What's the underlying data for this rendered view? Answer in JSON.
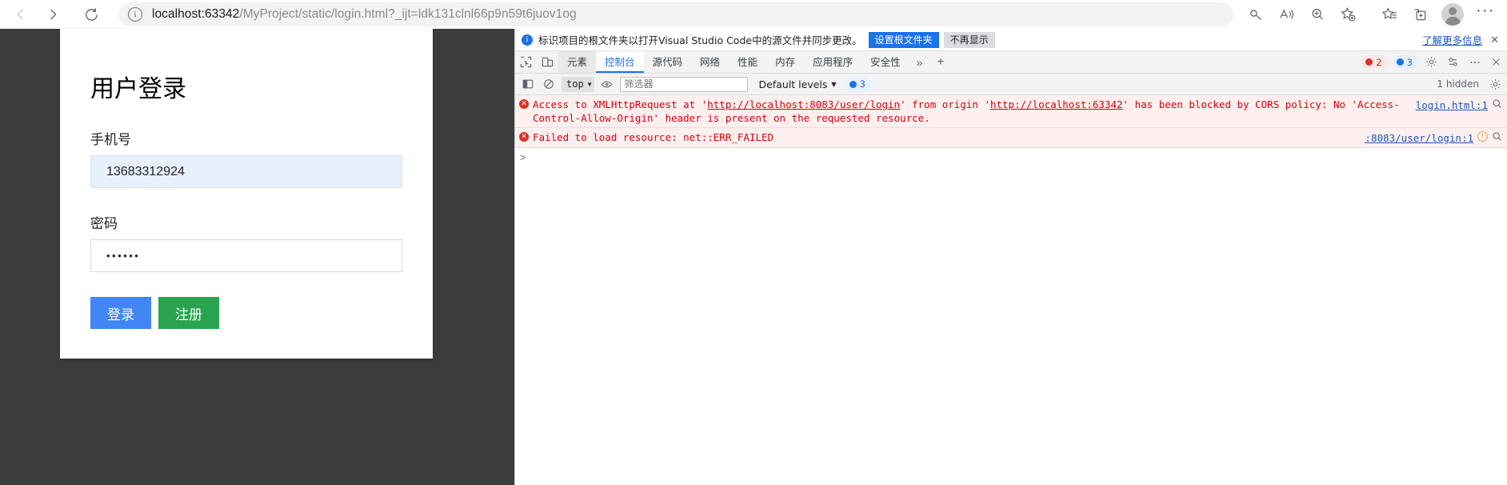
{
  "browser": {
    "nav": {
      "back_icon": "arrow-left-icon",
      "forward_icon": "arrow-right-icon",
      "reload_icon": "reload-icon"
    },
    "address": {
      "info_icon": "info-circle-icon",
      "host": "localhost:63342",
      "path": "/MyProject/static/login.html?_ijt=ldk131clnl66p9n59t6juov1og",
      "full_url": "localhost:63342/MyProject/static/login.html?_ijt=ldk131clnl66p9n59t6juov1og"
    },
    "toolbar_icons": [
      {
        "name": "key-icon",
        "label": "Password manager"
      },
      {
        "name": "read-aloud-icon",
        "label": "Read aloud"
      },
      {
        "name": "zoom-icon",
        "label": "Zoom"
      },
      {
        "name": "add-favorite-icon",
        "label": "Add to favorites"
      },
      {
        "name": "favorites-list-icon",
        "label": "Favorites"
      },
      {
        "name": "collections-icon",
        "label": "Collections"
      }
    ],
    "profile_icon": "profile-avatar-icon",
    "more_label": "···"
  },
  "login_page": {
    "title": "用户登录",
    "phone": {
      "label": "手机号",
      "value": "13683312924",
      "placeholder": ""
    },
    "password": {
      "label": "密码",
      "value": "••••••",
      "placeholder": ""
    },
    "login_button": "登录",
    "register_button": "注册",
    "colors": {
      "login_button_bg": "#4285f4",
      "register_button_bg": "#2aa44e",
      "autofill_bg": "#e8f0fe"
    }
  },
  "devtools": {
    "banner": {
      "info_icon": "info-circle-filled-icon",
      "text": "标识项目的根文件夹以打开Visual Studio Code中的源文件并同步更改。",
      "primary_button": "设置根文件夹",
      "secondary_button": "不再显示",
      "learn_more": "了解更多信息",
      "close_icon": "close-icon"
    },
    "tabbar": {
      "inspect_icon": "inspect-element-icon",
      "device_toolbar_icon": "device-toolbar-icon",
      "tabs": [
        {
          "label": "元素",
          "active": false,
          "highlighted": true
        },
        {
          "label": "控制台",
          "active": true,
          "highlighted": false
        },
        {
          "label": "源代码",
          "active": false,
          "highlighted": false
        },
        {
          "label": "网络",
          "active": false,
          "highlighted": false
        },
        {
          "label": "性能",
          "active": false,
          "highlighted": false
        },
        {
          "label": "内存",
          "active": false,
          "highlighted": false
        },
        {
          "label": "应用程序",
          "active": false,
          "highlighted": false
        },
        {
          "label": "安全性",
          "active": false,
          "highlighted": false
        }
      ],
      "overflow_label": "»",
      "add_tab_label": "+",
      "error_count": "2",
      "info_count": "3",
      "settings_icon": "gear-icon",
      "customize_icon": "customize-icon",
      "more_icon": "more-vertical-icon",
      "close_icon": "close-icon"
    },
    "console_toolbar": {
      "sidebar_icon": "console-sidebar-icon",
      "clear_icon": "clear-console-icon",
      "context": "top",
      "eye_icon": "live-expression-icon",
      "filter_placeholder": "筛选器",
      "filter_value": "",
      "level": "Default levels",
      "info_badge": "3",
      "hidden_label": "1 hidden",
      "settings_icon": "gear-icon"
    },
    "console_messages": [
      {
        "type": "error",
        "parts": [
          {
            "t": "text",
            "v": "Access to XMLHttpRequest at "
          },
          {
            "t": "text",
            "v": "'"
          },
          {
            "t": "link",
            "v": "http://localhost:8083/user/login"
          },
          {
            "t": "text",
            "v": "' from origin "
          },
          {
            "t": "text",
            "v": "'"
          },
          {
            "t": "link",
            "v": "http://localhost:63342"
          },
          {
            "t": "text",
            "v": "' has been blocked by CORS policy: No 'Access-Control-Allow-Origin' header is present on the requested resource."
          }
        ],
        "source": "login.html:1",
        "search_icon": "search-icon",
        "warn_icon": null
      },
      {
        "type": "error",
        "parts": [
          {
            "t": "text",
            "v": "Failed to load resource: net::ERR_FAILED"
          }
        ],
        "source": ":8083/user/login:1",
        "search_icon": "search-icon",
        "warn_icon": "warning-circle-icon"
      }
    ],
    "prompt_icon": "console-prompt-caret"
  }
}
